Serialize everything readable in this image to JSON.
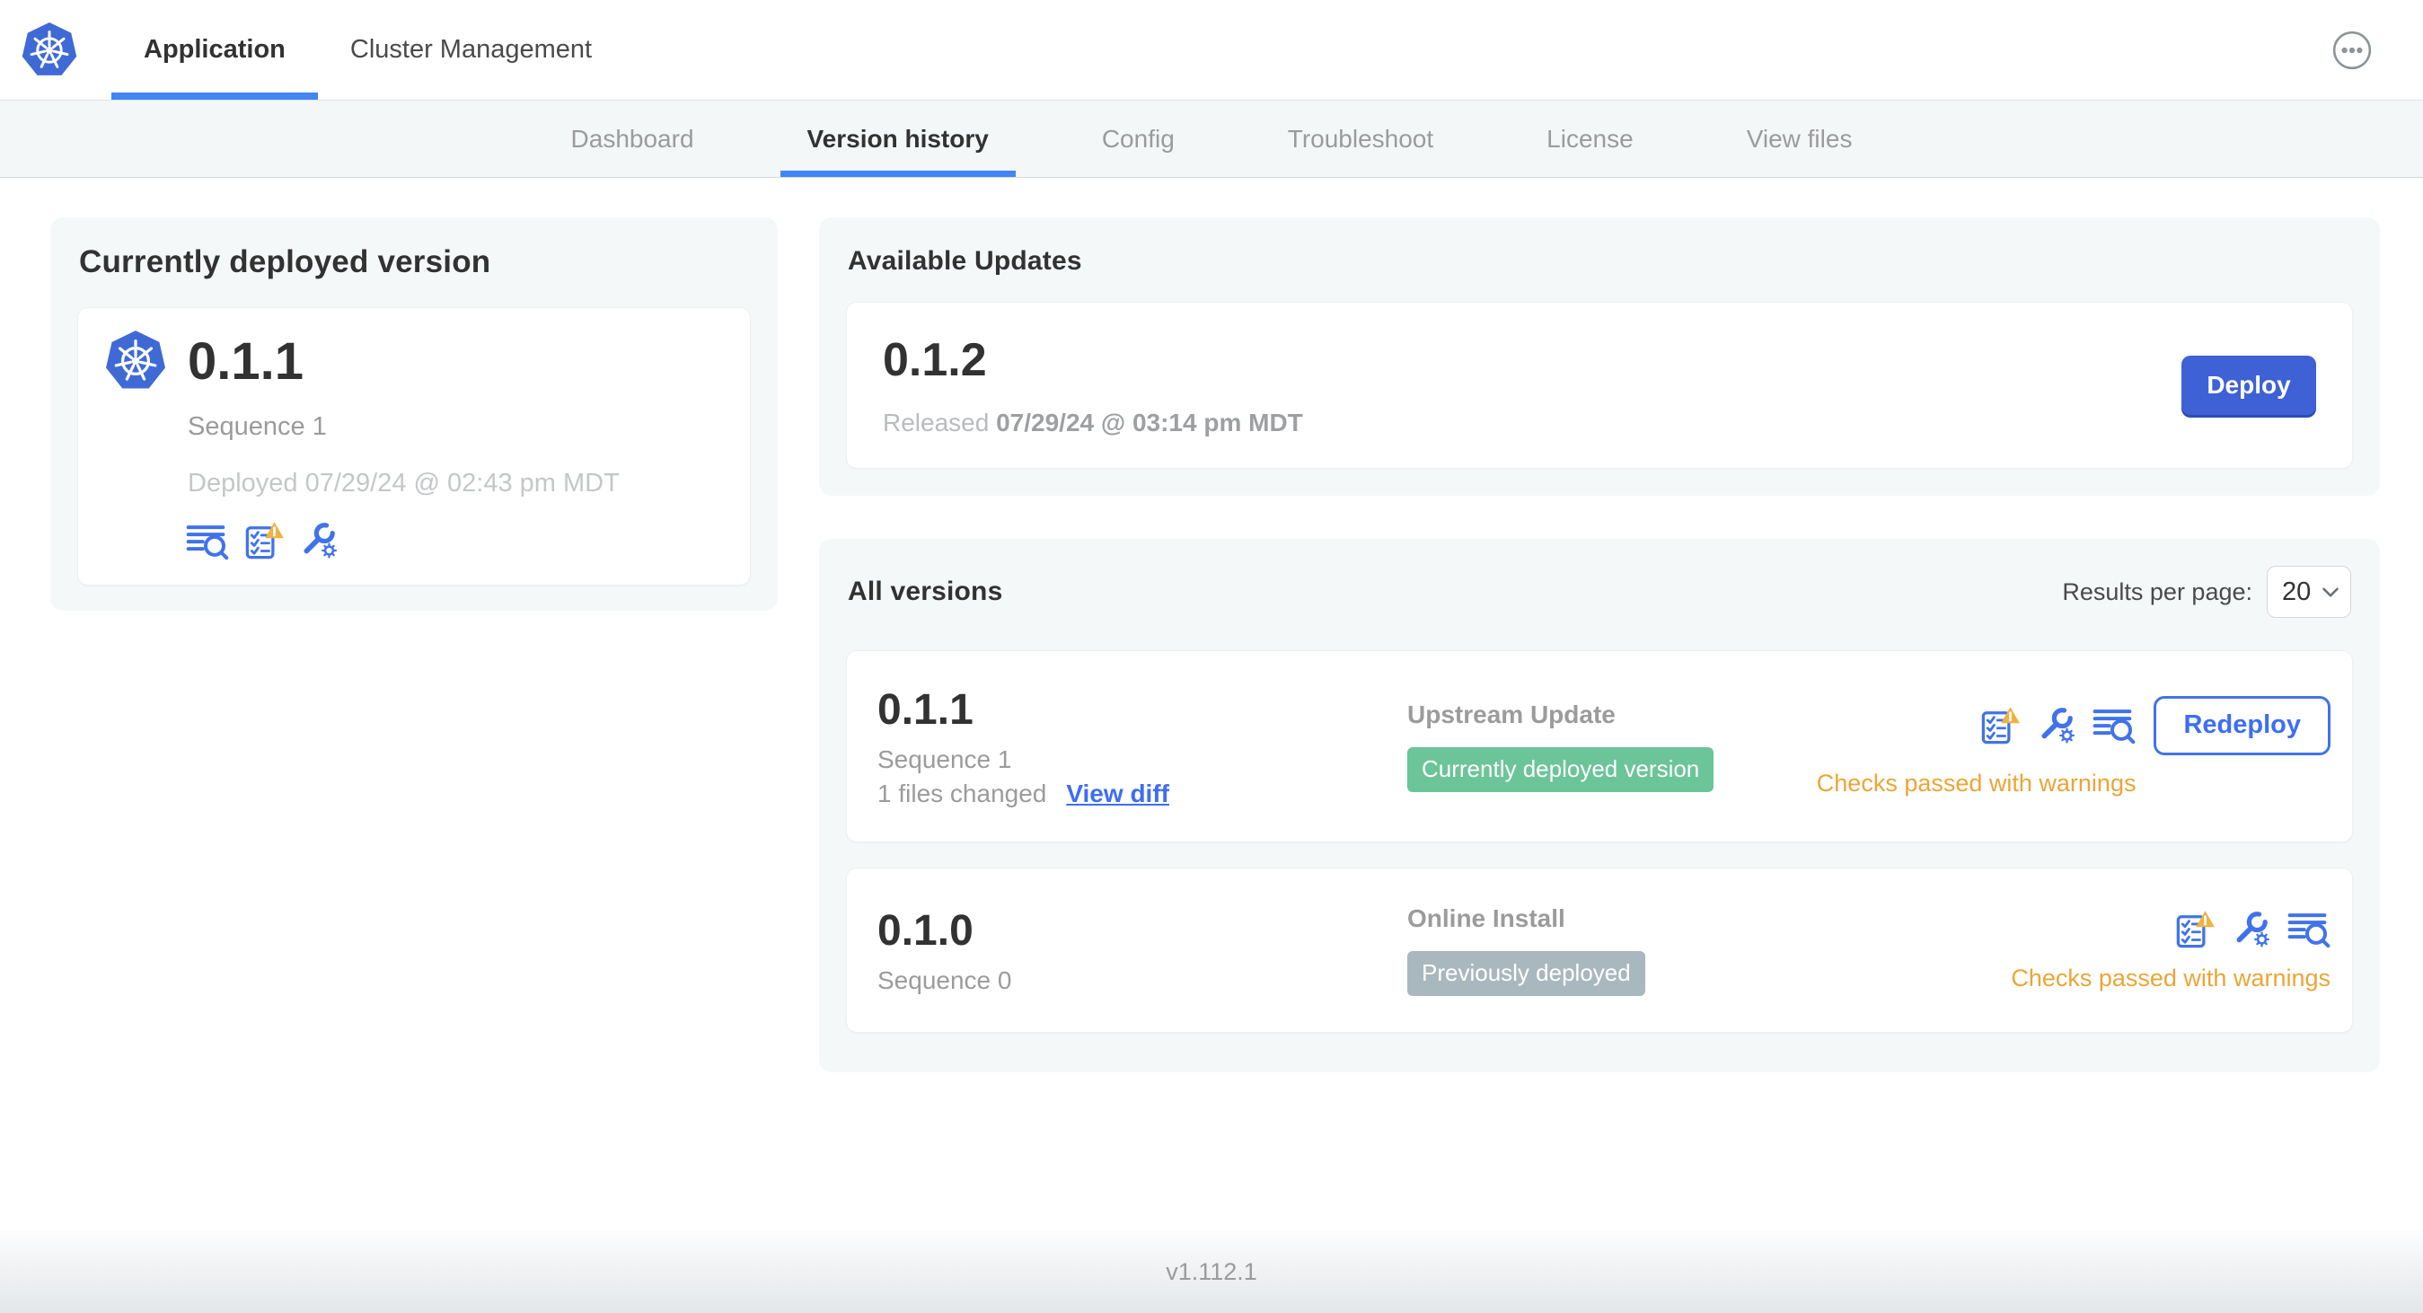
{
  "header": {
    "tabs": [
      {
        "label": "Application",
        "active": true
      },
      {
        "label": "Cluster Management",
        "active": false
      }
    ]
  },
  "subnav": {
    "active": "Version history",
    "tabs": [
      {
        "label": "Dashboard"
      },
      {
        "label": "Version history"
      },
      {
        "label": "Config"
      },
      {
        "label": "Troubleshoot"
      },
      {
        "label": "License"
      },
      {
        "label": "View files"
      }
    ]
  },
  "deployed_card": {
    "title": "Currently deployed version",
    "version": "0.1.1",
    "sequence": "Sequence 1",
    "deployed_at": "Deployed 07/29/24 @ 02:43 pm MDT"
  },
  "available_updates": {
    "title": "Available Updates",
    "version": "0.1.2",
    "released_label": "Released",
    "released_at": "07/29/24 @ 03:14 pm MDT",
    "deploy_label": "Deploy"
  },
  "all_versions": {
    "title": "All versions",
    "results_per_page_label": "Results per page:",
    "results_per_page_value": "20",
    "rows": [
      {
        "version": "0.1.1",
        "sequence": "Sequence 1",
        "files_changed": "1 files changed",
        "view_diff_label": "View diff",
        "source": "Upstream Update",
        "badge": "Currently deployed version",
        "badge_color": "#6cc499",
        "status": "Checks passed with warnings",
        "action_label": "Redeploy"
      },
      {
        "version": "0.1.0",
        "sequence": "Sequence 0",
        "source": "Online Install",
        "badge": "Previously deployed",
        "badge_color": "#a9b8be",
        "status": "Checks passed with warnings"
      }
    ]
  },
  "footer": {
    "version": "v1.112.1"
  },
  "icons": {
    "app_logo": "kubernetes-helm-logo",
    "top_right_menu": "ellipsis-in-circle",
    "diff": "lines-with-magnifier",
    "preflight": "checklist-with-warning-triangle",
    "config": "wrench-with-gear",
    "select_chevron": "chevron-down"
  },
  "colors": {
    "k8s_blue": "#3f6ad6",
    "primary_button_blue": "#3e61d6",
    "link_blue": "#3e6df5",
    "icon_blue": "#4073ea",
    "tab_underline_blue": "#4285f4",
    "warning_text": "#eca537",
    "warning_triangle": "#f0b13f",
    "badge_green": "#6cc499",
    "badge_gray": "#a9b8be",
    "card_background": "#f5f8f9",
    "subnav_background": "#f4f7f8",
    "text_dark": "#323232",
    "text_gray": "#9b9b9b",
    "text_light_gray": "#c4c7c9"
  }
}
